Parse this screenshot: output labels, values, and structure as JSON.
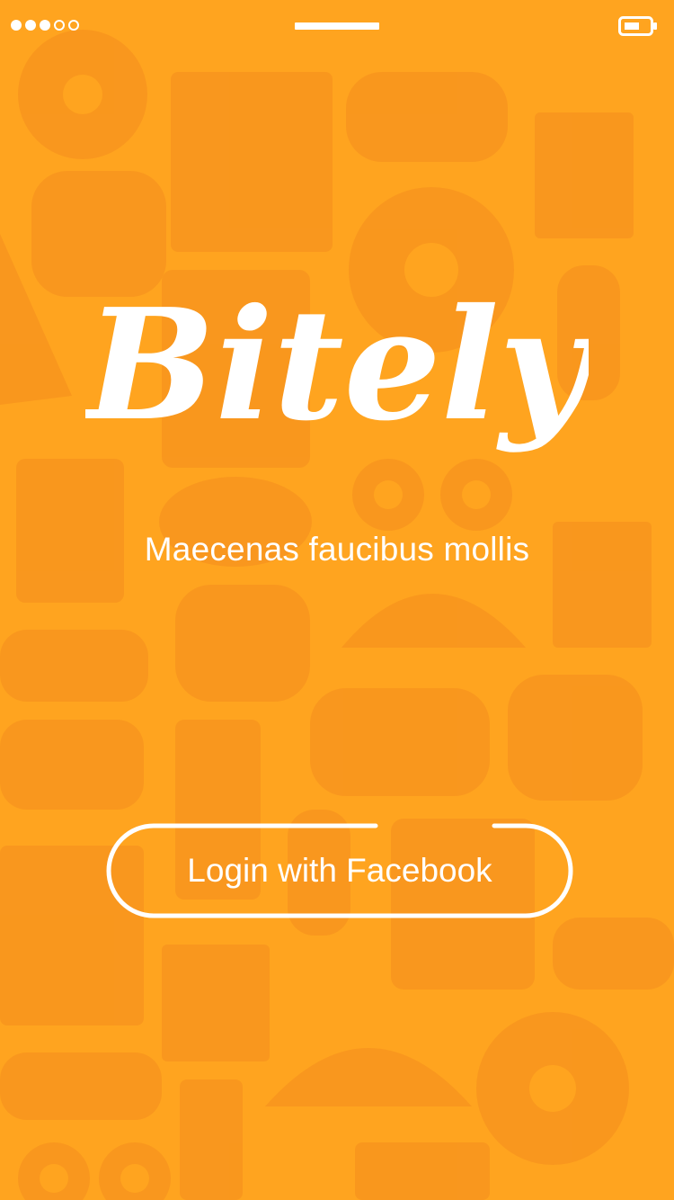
{
  "app": {
    "name": "Bitely",
    "tagline": "Maecenas faucibus mollis",
    "colors": {
      "background": "#FFA41F",
      "pattern": "#F7931E",
      "text": "#FFFFFF"
    }
  },
  "status_bar": {
    "signal_bars_filled": 3,
    "signal_bars_total": 5,
    "battery_level": 0.55
  },
  "actions": {
    "facebook_login_label": "Login with Facebook"
  }
}
